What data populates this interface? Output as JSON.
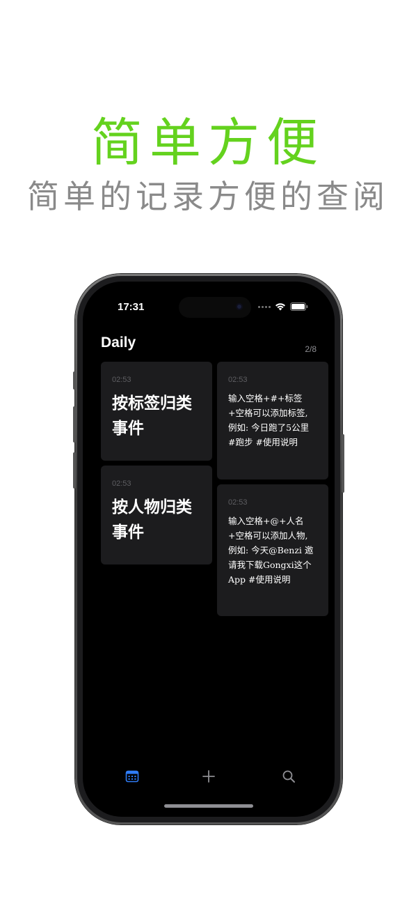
{
  "promo": {
    "headline": "简单方便",
    "subhead": "简单的记录方便的查阅"
  },
  "status_bar": {
    "time": "17:31"
  },
  "header": {
    "title": "Daily",
    "page_count": "2/8"
  },
  "cards": [
    {
      "time": "02:53",
      "title": "按标签归类事件"
    },
    {
      "time": "02:53",
      "title": "按人物归类事件"
    },
    {
      "time": "02:53",
      "body": "输入空格+#+标签+空格可以添加标签, 例如: 今日跑了5公里 #跑步 #使用说明"
    },
    {
      "time": "02:53",
      "body": "输入空格+@+人名+空格可以添加人物, 例如: 今天@Benzi 邀请我下载Gongxi这个App #使用说明"
    }
  ],
  "tabbar": {
    "items": [
      {
        "icon": "calendar-icon",
        "active": true
      },
      {
        "icon": "plus-icon",
        "active": false
      },
      {
        "icon": "search-icon",
        "active": false
      }
    ]
  },
  "colors": {
    "headline": "#64d21e",
    "subhead": "#8a8a8a",
    "screen_background": "#000000",
    "card_background": "#1c1c1e",
    "tab_active": "#2f7cf6",
    "tab_inactive": "#8e8e93"
  }
}
